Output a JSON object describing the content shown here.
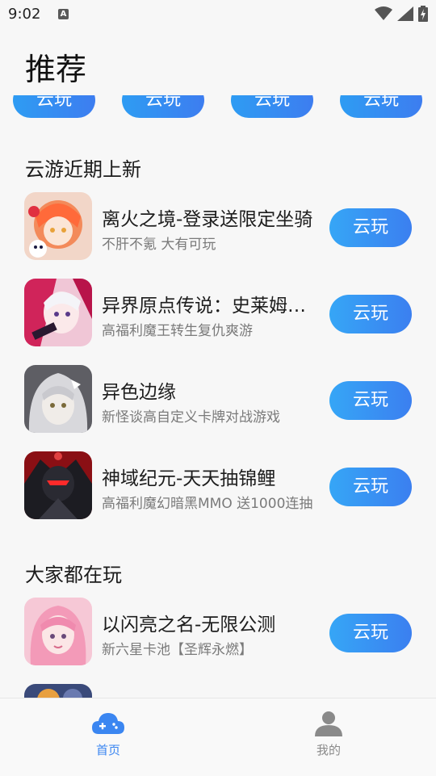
{
  "status_bar": {
    "time": "9:02",
    "badge": "A"
  },
  "page": {
    "title": "推荐"
  },
  "top_row": {
    "buttons": [
      "云玩",
      "云玩",
      "云玩",
      "云玩"
    ]
  },
  "sections": [
    {
      "title": "云游近期上新",
      "games": [
        {
          "name": "离火之境-登录送限定坐骑",
          "desc": "不肝不氪 大有可玩",
          "button": "云玩"
        },
        {
          "name": "异界原点传说：史莱姆转生",
          "desc": "高福利魔王转生复仇爽游",
          "button": "云玩"
        },
        {
          "name": "异色边缘",
          "desc": "新怪谈高自定义卡牌对战游戏",
          "button": "云玩"
        },
        {
          "name": "神域纪元-天天抽锦鲤",
          "desc": "高福利魔幻暗黑MMO 送1000连抽",
          "button": "云玩"
        }
      ]
    },
    {
      "title": "大家都在玩",
      "games": [
        {
          "name": "以闪亮之名-无限公测",
          "desc": "新六星卡池【圣辉永燃】",
          "button": "云玩"
        }
      ]
    }
  ],
  "bottom_nav": {
    "items": [
      {
        "label": "首页",
        "icon": "cloud-gamepad-icon",
        "active": true
      },
      {
        "label": "我的",
        "icon": "person-icon",
        "active": false
      }
    ]
  },
  "colors": {
    "accent": "#3b86f1",
    "inactive": "#8a8a8a",
    "button_start": "#36a6f6",
    "button_end": "#3b7ff0"
  }
}
